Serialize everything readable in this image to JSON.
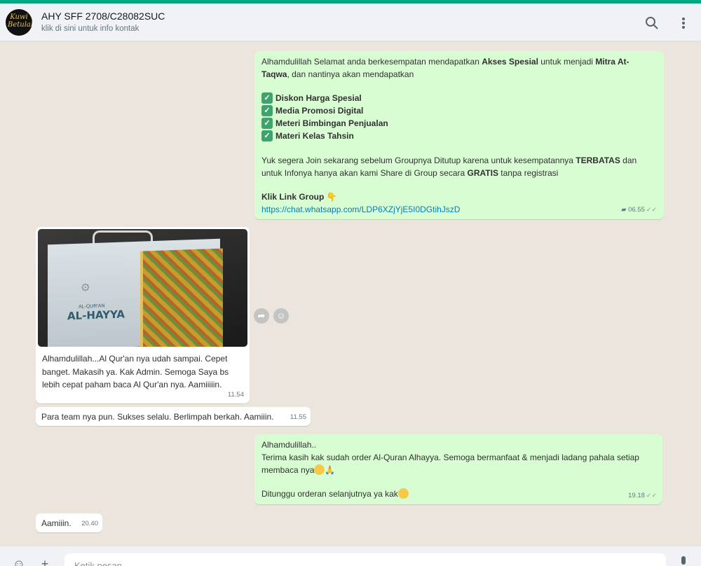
{
  "header": {
    "title": "AHY SFF 2708/C28082SUC",
    "subtitle": "klik di sini untuk info kontak",
    "avatar_text": "Kuwi Betulah",
    "search_icon": "search-icon",
    "menu_icon": "kebab-menu-icon"
  },
  "messages": {
    "m1": {
      "intro_a": "Alhamdulillah Selamat anda berkesempatan mendapatkan ",
      "intro_b": "Akses Spesial",
      "intro_c": " untuk menjadi ",
      "intro_d": "Mitra At-Taqwa",
      "intro_e": ", dan nantinya akan mendapatkan",
      "items": [
        "Diskon Harga Spesial",
        "Media Promosi Digital",
        "Meteri Bimbingan Penjualan",
        "Materi Kelas Tahsin"
      ],
      "para_a": "Yuk segera Join sekarang sebelum Groupnya Ditutup karena untuk kesempatannya ",
      "para_b": "TERBATAS",
      "para_c": " dan untuk Infonya hanya akan kami Share di Group secara ",
      "para_d": "GRATIS",
      "para_e": " tanpa registrasi",
      "cta": "Klik Link Group",
      "cta_emoji": "👇",
      "link": "https://chat.whatsapp.com/LDP6XZjYjE5I0DGtihJszD",
      "time": "06.55"
    },
    "m2": {
      "image_title": "AL-HAYYA",
      "image_subtitle": "AL-QUR'AN",
      "caption": "Alhamdulillah...Al Qur'an nya udah sampai. Cepet banget.  Makasih ya. Kak Admin. Semoga Saya bs lebih cepat paham baca Al Qur'an nya. Aamiiiiin.",
      "time": "11.54"
    },
    "m3": {
      "text": "Para team nya pun. Sukses selalu. Berlimpah berkah. Aamiiin.",
      "time": "11.55"
    },
    "m4": {
      "line1": "Alhamdulillah..",
      "line2": "Terima kasih kak sudah order Al-Quran Alhayya. Semoga bermanfaat & menjadi ladang pahala setiap membaca nya",
      "line2_emoji": "🙏",
      "line3": "Ditunggu orderan selanjutnya ya kak",
      "time": "19.18"
    },
    "m5": {
      "text": "Aamiiin.",
      "time": "20.40"
    }
  },
  "footer": {
    "placeholder": "Ketik pesan"
  },
  "colors": {
    "accent": "#00a884",
    "outgoing": "#d9fdd3",
    "incoming": "#ffffff",
    "link": "#027eb5"
  }
}
